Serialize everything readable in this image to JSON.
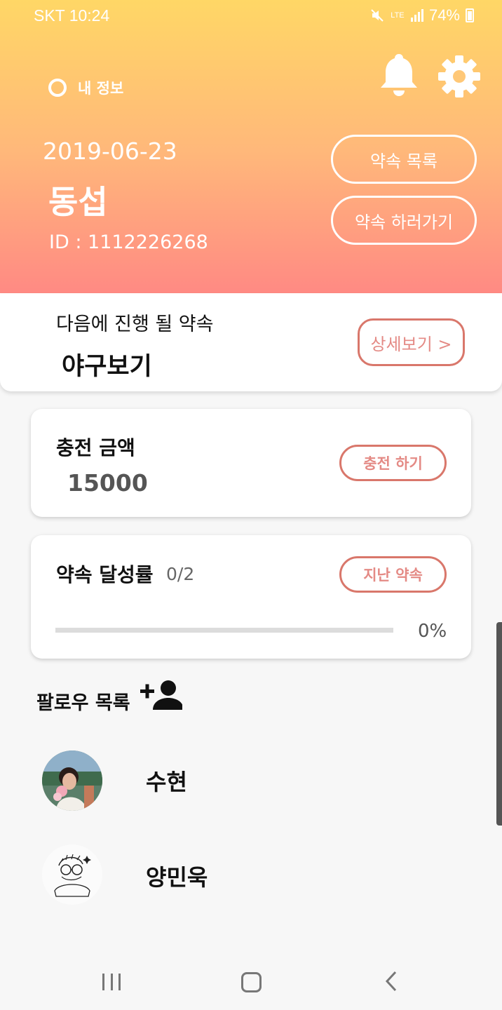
{
  "status_bar": {
    "carrier_time": "SKT 10:24",
    "lte_label": "LTE",
    "battery": "74%"
  },
  "header": {
    "profile_label": "내 정보",
    "date": "2019-06-23",
    "name": "동섭",
    "user_id": "ID : 1112226268",
    "promise_list_button": "약속 목록",
    "go_promise_button": "약속 하러가기"
  },
  "next_promise": {
    "title": "다음에 진행 될 약속",
    "name": "야구보기",
    "detail_button": "상세보기 >"
  },
  "charge": {
    "title": "충전 금액",
    "amount": "15000",
    "charge_button": "충전 하기"
  },
  "achievement": {
    "title": "약속 달성률",
    "count": "0/2",
    "past_button": "지난 약속",
    "progress_percent": 0,
    "progress_text": "0%"
  },
  "follow": {
    "title": "팔로우 목록",
    "friends": [
      {
        "name": "수현"
      },
      {
        "name": "양민욱"
      }
    ]
  },
  "icons": {
    "bell": "bell-icon",
    "settings": "gear-icon",
    "add_person": "add-person-icon"
  },
  "colors": {
    "header_top": "#ffd766",
    "header_bottom": "#ff8784",
    "accent": "#e48a85",
    "accent_border": "#d9776b"
  }
}
